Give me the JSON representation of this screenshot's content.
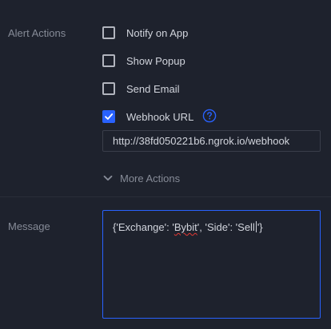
{
  "alert_actions": {
    "label": "Alert Actions",
    "options": [
      {
        "label": "Notify on App",
        "checked": false
      },
      {
        "label": "Show Popup",
        "checked": false
      },
      {
        "label": "Send Email",
        "checked": false
      },
      {
        "label": "Webhook URL",
        "checked": true
      }
    ],
    "help_icon": "question-circle-icon",
    "webhook_url": "http://38fd050221b6.ngrok.io/webhook",
    "more_actions_label": "More Actions",
    "more_actions_icon": "chevron-down-icon"
  },
  "message": {
    "label": "Message",
    "text_part1": "{'Exchange': '",
    "text_misspelled": "Bybit",
    "text_part2": "', 'Side': 'Sell",
    "text_part3": "'}"
  },
  "colors": {
    "background": "#1e222d",
    "accent": "#2962ff",
    "label_muted": "#868b97",
    "text": "#d1d4dc"
  }
}
